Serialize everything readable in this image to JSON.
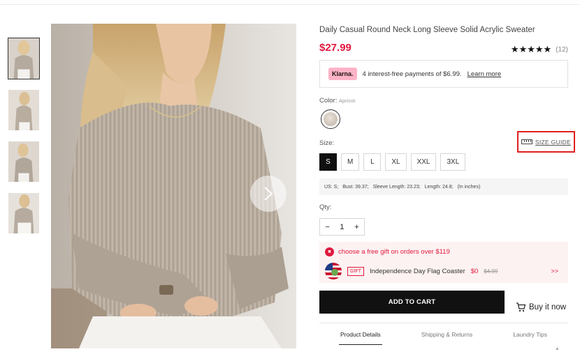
{
  "product": {
    "title": "Daily Casual Round Neck Long Sleeve Solid Acrylic Sweater",
    "price": "$27.99",
    "stars": "★★★★★",
    "rating_count": "(12)"
  },
  "klarna": {
    "badge": "Klarna.",
    "text": "4 interest-free payments of $6.99.",
    "link": "Learn more"
  },
  "color": {
    "label": "Color:",
    "value": "Apricot"
  },
  "size": {
    "label": "Size:",
    "guide": "SIZE GUIDE",
    "options": [
      "S",
      "M",
      "L",
      "XL",
      "XXL",
      "3XL"
    ],
    "selected": "S"
  },
  "measurements": {
    "us": "US: S;",
    "bust": "Bust: 39.37;",
    "sleeve": "Sleeve Length: 23.23;",
    "length": "Length: 24.8;",
    "unit": "(In inches)"
  },
  "qty": {
    "label": "Qty:",
    "minus": "−",
    "value": "1",
    "plus": "+"
  },
  "gift": {
    "promo": "choose a free gift on orders over $119",
    "tag": "GIFT",
    "name": "Independence Day Flag Coaster",
    "price": "$0",
    "old_price": "$4.99",
    "more": ">>"
  },
  "actions": {
    "add_to_cart": "ADD TO CART",
    "buy_now": "Buy it now"
  },
  "tabs": [
    "Product Details",
    "Shipping & Returns",
    "Laundry Tips"
  ],
  "icons": {
    "next": "chevron-right-icon",
    "ruler": "ruler-icon",
    "gift": "gift-icon",
    "cart": "cart-icon"
  },
  "colors": {
    "accent": "#e0193e",
    "highlight_box": "#e0201f",
    "klarna_pink": "#ffb3c7"
  }
}
